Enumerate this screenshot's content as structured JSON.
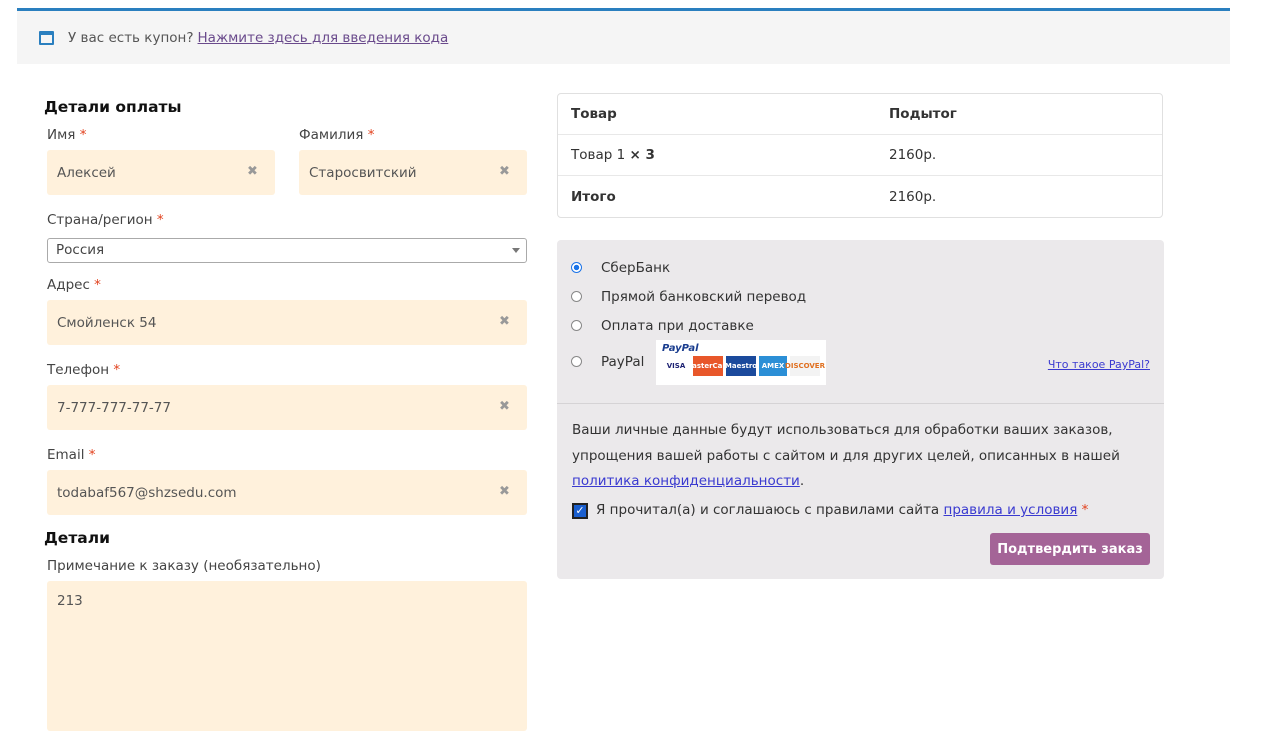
{
  "notice": {
    "text": "У вас есть купон?",
    "link": "Нажмите здесь для введения кода"
  },
  "billing": {
    "title": "Детали оплаты",
    "first_name_label": "Имя",
    "first_name": "Алексей",
    "last_name_label": "Фамилия",
    "last_name": "Старосвитский",
    "country_label": "Страна/регион",
    "country": "Россия",
    "address_label": "Адрес",
    "address": "Смойленск 54",
    "phone_label": "Телефон",
    "phone": "7-777-777-77-77",
    "email_label": "Email",
    "email": "todabaf567@shzsedu.com",
    "required": "*"
  },
  "details": {
    "title": "Детали",
    "note_label": "Примечание к заказу (необязательно)",
    "note": "213"
  },
  "order": {
    "col_product": "Товар",
    "col_subtotal": "Подытог",
    "item": "Товар 1",
    "qty": "× 3",
    "item_subtotal": "2160р.",
    "total_label": "Итого",
    "total": "2160р."
  },
  "payment": {
    "methods": [
      "СберБанк",
      "Прямой банковский перевод",
      "Оплата при доставке",
      "PayPal"
    ],
    "selected": 0,
    "paypal_logo": "PayPal",
    "paypal_link": "Что такое PayPal?",
    "cards": [
      "VISA",
      "MasterCard",
      "Maestro",
      "AMEX",
      "DISCOVER"
    ],
    "privacy_text": "Ваши личные данные будут использоваться для обработки ваших заказов, упрощения вашей работы с сайтом и для других целей, описанных в нашей",
    "privacy_link": "политика конфиденциальности",
    "terms_text": "Я прочитал(а) и соглашаюсь с правилами сайта",
    "terms_link": "правила и условия",
    "submit": "Подтвердить заказ"
  }
}
